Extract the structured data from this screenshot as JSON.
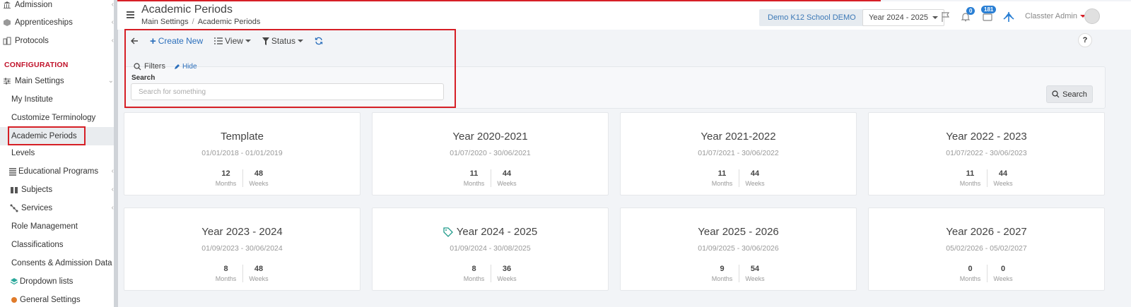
{
  "sidebar": {
    "items": [
      {
        "label": "Admission",
        "icon": "bank-icon"
      },
      {
        "label": "Apprenticeships",
        "icon": "cube-icon"
      },
      {
        "label": "Protocols",
        "icon": "building-icon"
      }
    ],
    "section_label": "CONFIGURATION",
    "main_settings": {
      "label": "Main Settings",
      "icon": "sliders-icon"
    },
    "sub_items": [
      "My Institute",
      "Customize Terminology",
      "Academic Periods",
      "Levels",
      "Educational Programs",
      "Subjects",
      "Services",
      "Role Management",
      "Classifications",
      "Consents & Admission Data",
      "Dropdown lists",
      "General Settings"
    ]
  },
  "header": {
    "title": "Academic Periods",
    "breadcrumb": [
      "Main Settings",
      "Academic Periods"
    ],
    "school": "Demo K12 School DEMO",
    "year": "Year 2024 - 2025",
    "notif_count": "0",
    "msg_count": "181",
    "user": "Classter Admin"
  },
  "toolbar": {
    "create_label": "Create New",
    "view_label": "View",
    "status_label": "Status"
  },
  "filters": {
    "title": "Filters",
    "hide_label": "Hide",
    "search_label": "Search",
    "search_placeholder": "Search for something",
    "search_button": "Search",
    "help": "?"
  },
  "cards": [
    {
      "title": "Template",
      "dates": "01/01/2018 - 01/01/2019",
      "months": "12",
      "weeks": "48",
      "months_label": "Months",
      "weeks_label": "Weeks"
    },
    {
      "title": "Year 2020-2021",
      "dates": "01/07/2020 - 30/06/2021",
      "months": "11",
      "weeks": "44",
      "months_label": "Months",
      "weeks_label": "Weeks"
    },
    {
      "title": "Year 2021-2022",
      "dates": "01/07/2021 - 30/06/2022",
      "months": "11",
      "weeks": "44",
      "months_label": "Months",
      "weeks_label": "Weeks"
    },
    {
      "title": "Year 2022 - 2023",
      "dates": "01/07/2022 - 30/06/2023",
      "months": "11",
      "weeks": "44",
      "months_label": "Months",
      "weeks_label": "Weeks"
    },
    {
      "title": "Year 2023 - 2024",
      "dates": "01/09/2023 - 30/06/2024",
      "months": "8",
      "weeks": "48",
      "months_label": "Months",
      "weeks_label": "Weeks"
    },
    {
      "title": "Year 2024 - 2025",
      "dates": "01/09/2024 - 30/08/2025",
      "months": "8",
      "weeks": "36",
      "months_label": "Months",
      "weeks_label": "Weeks"
    },
    {
      "title": "Year 2025 - 2026",
      "dates": "01/09/2025 - 30/06/2026",
      "months": "9",
      "weeks": "54",
      "months_label": "Months",
      "weeks_label": "Weeks"
    },
    {
      "title": "Year 2026 - 2027",
      "dates": "05/02/2026 - 05/02/2027",
      "months": "0",
      "weeks": "0",
      "months_label": "Months",
      "weeks_label": "Weeks"
    }
  ],
  "colors": {
    "accent": "#2a6ebb",
    "highlight": "#d61f26",
    "section": "#c0122a"
  }
}
